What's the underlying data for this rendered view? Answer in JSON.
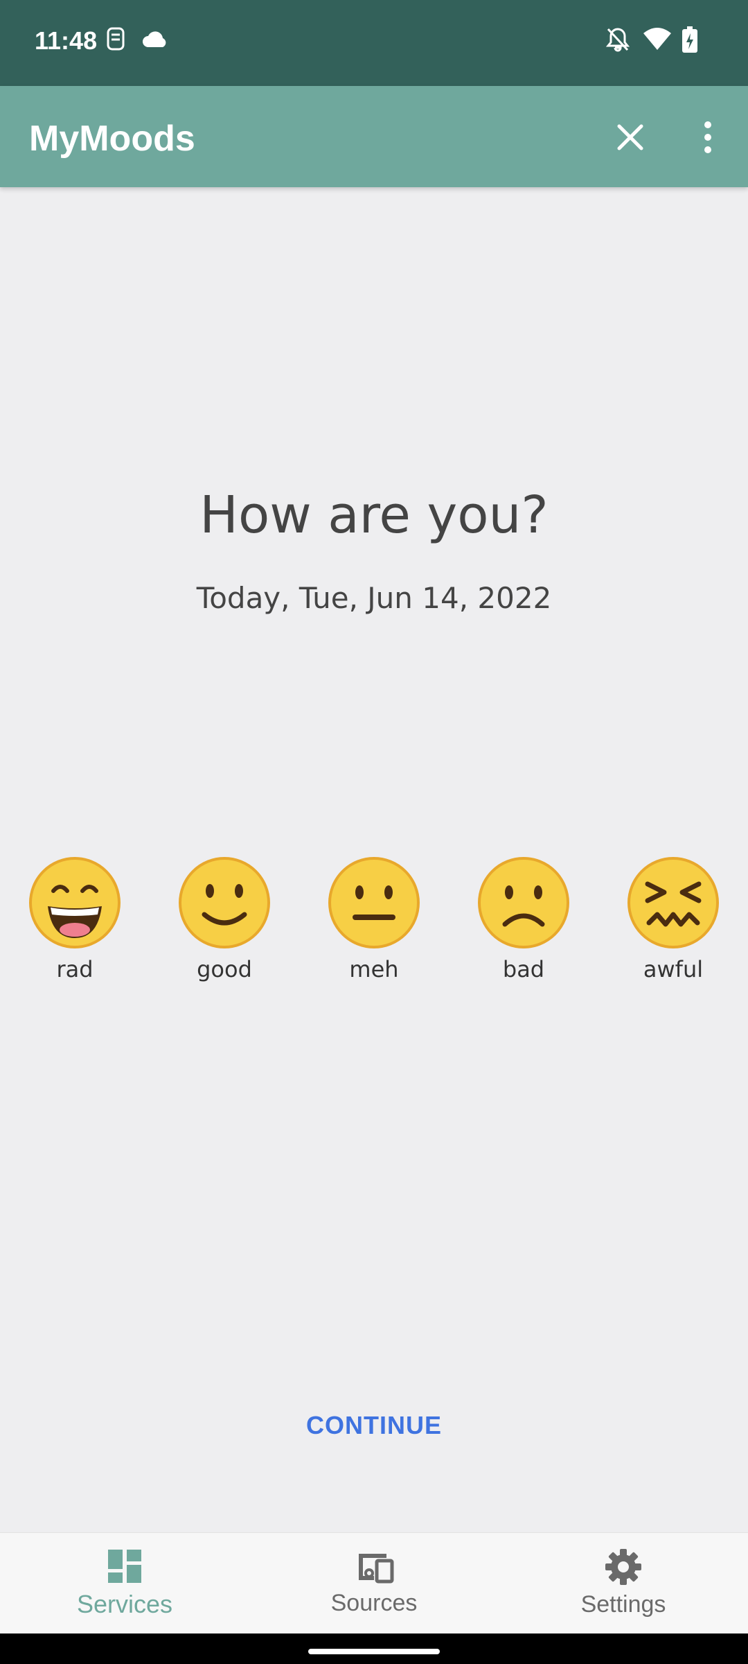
{
  "status_bar": {
    "time": "11:48",
    "icons": [
      "sim-icon",
      "cloud-icon",
      "notifications-off-icon",
      "wifi-icon",
      "battery-charging-icon"
    ]
  },
  "app_bar": {
    "title": "MyMoods",
    "close_icon": "close-icon",
    "more_icon": "more-vert-icon"
  },
  "main": {
    "heading": "How are you?",
    "date": "Today, Tue, Jun 14, 2022",
    "moods": [
      {
        "label": "rad",
        "icon": "grinning-face"
      },
      {
        "label": "good",
        "icon": "slightly-smiling-face"
      },
      {
        "label": "meh",
        "icon": "neutral-face"
      },
      {
        "label": "bad",
        "icon": "slightly-frowning-face"
      },
      {
        "label": "awful",
        "icon": "confounded-face"
      }
    ],
    "continue_label": "CONTINUE"
  },
  "bottom_nav": {
    "items": [
      {
        "label": "Services",
        "icon": "dashboard-icon",
        "active": true
      },
      {
        "label": "Sources",
        "icon": "devices-icon",
        "active": false
      },
      {
        "label": "Settings",
        "icon": "gear-icon",
        "active": false
      }
    ]
  },
  "colors": {
    "status_bar": "#33615a",
    "app_bar": "#6fa89d",
    "accent": "#3f73e0",
    "active_nav": "#6fa89d"
  }
}
